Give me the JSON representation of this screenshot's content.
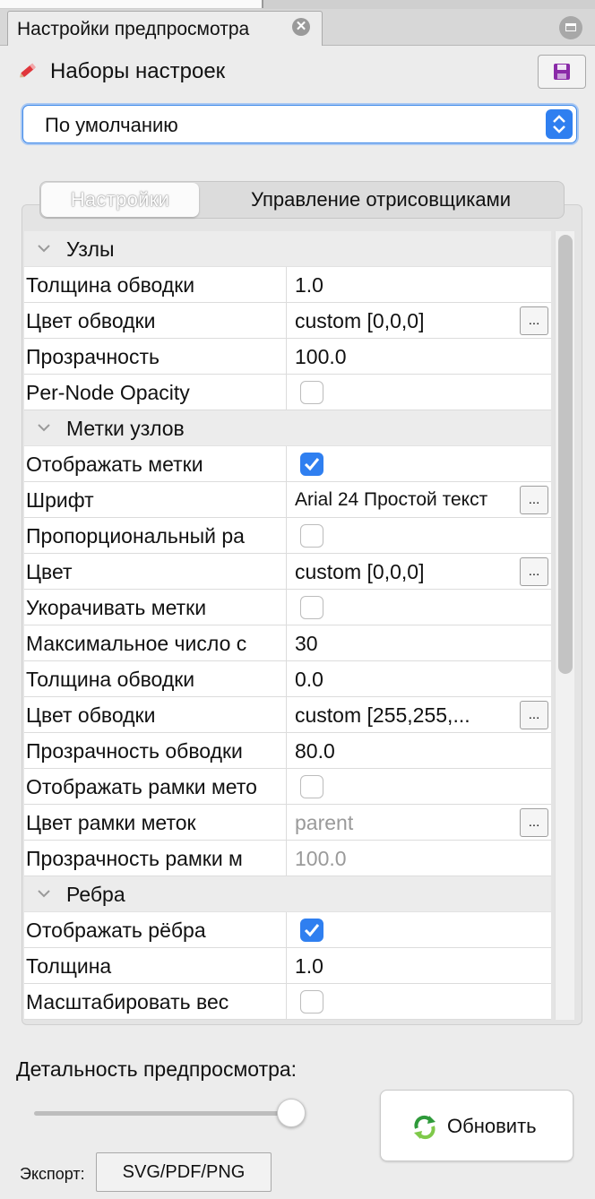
{
  "window": {
    "tab_title": "Настройки предпросмотра",
    "close_glyph": "✕"
  },
  "presets": {
    "label": "Наборы настроек",
    "selected": "По умолчанию",
    "icons": [
      "pencil-icon",
      "save-icon",
      "chevron-updown-icon"
    ]
  },
  "tabs": [
    {
      "label": "Настройки",
      "active": true
    },
    {
      "label": "Управление отрисовщиками",
      "active": false
    }
  ],
  "categories": {
    "nodes": "Узлы",
    "node_labels": "Метки узлов",
    "edges": "Ребра"
  },
  "properties": {
    "nodes": [
      {
        "name": "Толщина обводки",
        "value": "1.0"
      },
      {
        "name": "Цвет обводки",
        "value": "custom [0,0,0]"
      },
      {
        "name": "Прозрачность",
        "value": "100.0"
      },
      {
        "name": "Per-Node Opacity",
        "checked": false
      }
    ],
    "node_labels": [
      {
        "name": "Отображать метки",
        "checked": true
      },
      {
        "name": "Шрифт",
        "value": "Arial 24 Простой текст"
      },
      {
        "name": "Пропорциональный ра",
        "checked": false
      },
      {
        "name": "Цвет",
        "value": "custom [0,0,0]"
      },
      {
        "name": "Укорачивать метки",
        "checked": false
      },
      {
        "name": "Максимальное число с",
        "value": "30"
      },
      {
        "name": "Толщина обводки",
        "value": "0.0"
      },
      {
        "name": "Цвет обводки",
        "value": "custom [255,255,..."
      },
      {
        "name": "Прозрачность обводки",
        "value": "80.0"
      },
      {
        "name": "Отображать рамки мето",
        "checked": false
      },
      {
        "name": "Цвет рамки меток",
        "value": "parent"
      },
      {
        "name": "Прозрачность рамки м",
        "value": "100.0"
      }
    ],
    "edges": [
      {
        "name": "Отображать рёбра",
        "checked": true
      },
      {
        "name": "Толщина",
        "value": "1.0"
      },
      {
        "name": "Масштабировать вес",
        "checked": false
      }
    ],
    "ellipsis": "..."
  },
  "preview": {
    "detail_label": "Детальность предпросмотра:",
    "detail_level": 0.95,
    "refresh_label": "Обновить",
    "export_label": "Экспорт:",
    "export_button": "SVG/PDF/PNG"
  },
  "colors": {
    "accent": "#2f7ff0",
    "panel_bg": "#ececec"
  }
}
